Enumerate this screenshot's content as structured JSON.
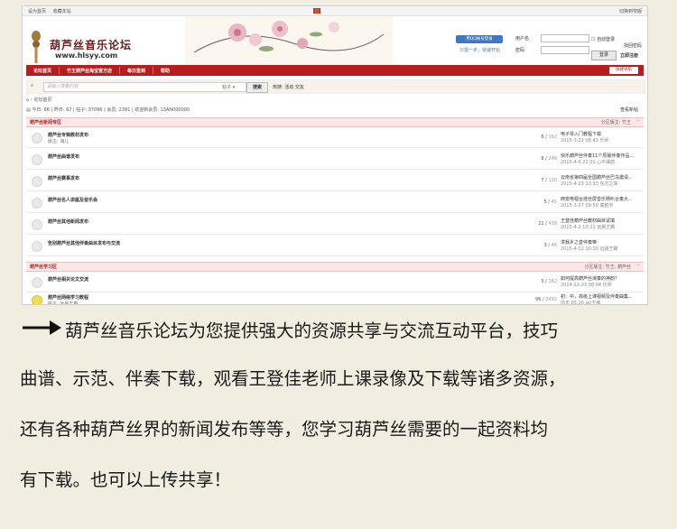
{
  "topbar": {
    "left": [
      "设为首页",
      "收藏本站"
    ],
    "right": "切换到窄版"
  },
  "header": {
    "logo_title": "葫芦丝音乐论坛",
    "logo_url": "www.hlsyy.com"
  },
  "login": {
    "qq_button": "用QQ帐号登录",
    "register_hint": "只需一步，快速开始",
    "user_label": "用户名",
    "pass_label": "密码",
    "auto_login": "自动登录",
    "find_pwd": "找回密码",
    "login_button": "登录",
    "register": "立即注册"
  },
  "nav": {
    "items": [
      "论坛首页",
      "竹王葫芦丝淘宝官方店",
      "每日签到",
      "帮助"
    ],
    "quick": "快捷导航"
  },
  "search": {
    "placeholder": "请输入搜索内容",
    "scope": "帖子",
    "button": "搜索",
    "hot_label": "热搜:",
    "hot": "活动 交友"
  },
  "breadcrumb": "论坛首页",
  "stats": {
    "text": "今日: 66 | 昨日: 67 | 帖子: 37096 | 会员: 2391 | 欢迎新会员: 13AN000000",
    "byd": "查看新帖"
  },
  "sections": [
    {
      "title": "葫芦丝新闻专区",
      "moderators": "分区版主: 竹王",
      "boards": [
        {
          "name": "葫芦丝专辑教材发布",
          "mod": "版主: 海儿",
          "count": "6",
          "posts": "192",
          "last": "电子琴入门教程下载",
          "time": "2015-3-22 08:43 乐师"
        },
        {
          "name": "葫芦丝曲谱发布",
          "mod": "",
          "count": "8",
          "posts": "246",
          "last": "快乐葫芦丝伴奏11个原版伴奏作品...",
          "time": "2015-4-6 22:01 心平曲韵"
        },
        {
          "name": "葫芦丝赛事发布",
          "mod": "",
          "count": "7",
          "posts": "120",
          "last": "云南省第四届全国葫芦丝巴乌邀请...",
          "time": "2015-4-23 13:33 东方之珠"
        },
        {
          "name": "葫芦丝名人讲座及音乐会",
          "mod": "",
          "count": "5",
          "posts": "45",
          "last": "西安电视台挂丝屏音乐杨叭合奏大...",
          "time": "2015-3-27 09:50 童鹤宇"
        },
        {
          "name": "葫芦丝其他新闻发布",
          "mod": "",
          "count": "21",
          "posts": "438",
          "last": "王登佳葫芦丝教材曲目试填",
          "time": "2015-4-2 10:21 远晨王霸"
        },
        {
          "name": "告别葫芦丝其他伴奏曲目发布与交流",
          "mod": "",
          "count": "3",
          "posts": "46",
          "last": "求我乡之音伴奏带",
          "time": "2015-4-12 10:10 远晨王霸"
        }
      ]
    },
    {
      "title": "葫芦丝学习区",
      "moderators": "分区版主: 竹王, 葫芦丝",
      "boards": [
        {
          "name": "葫芦丝相关论文交流",
          "mod": "",
          "count": "5",
          "posts": "182",
          "last": "如何提高葫芦丝演奏的神韵？",
          "time": "2014-12-23 08:04 乐师"
        },
        {
          "name": "葫芦丝网络学习教程",
          "mod": "版主: 远晨王霸",
          "count": "96",
          "posts": "2493",
          "last": "初：中，高级上课视频及伴奏曲集...",
          "time": "前天 05:26 wz五维"
        }
      ]
    }
  ],
  "description": {
    "lines": [
      "葫芦丝音乐论坛为您提供强大的资源共享与交流互动平台，技巧",
      "曲谱、示范、伴奏下载，观看王登佳老师上课录像及下载等诸多资源，",
      "还有各种葫芦丝界的新闻发布等等，您学习葫芦丝需要的一起资料均",
      "有下载。也可以上传共享！"
    ]
  }
}
